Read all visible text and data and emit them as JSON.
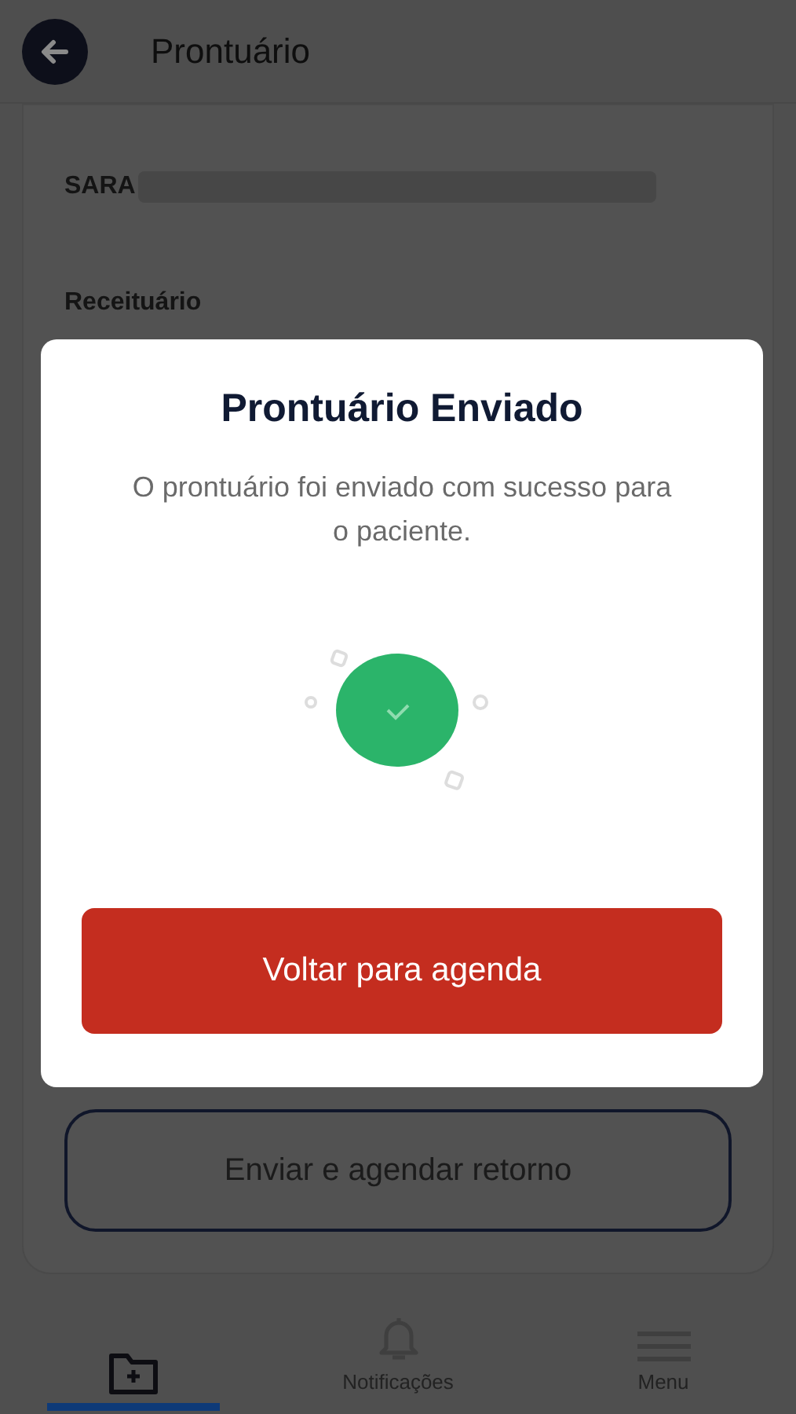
{
  "header": {
    "title": "Prontuário"
  },
  "record": {
    "patient_name": "SARA",
    "section_title": "Receituário"
  },
  "secondary_button": "Enviar e agendar retorno",
  "bottom_nav": [
    {
      "kind": "folder",
      "selected": true
    },
    {
      "kind": "bell",
      "label": "Notificações",
      "selected": false
    },
    {
      "kind": "menu",
      "label": "Menu",
      "selected": false
    }
  ],
  "dialog": {
    "title": "Prontuário Enviado",
    "message": "O prontuário foi enviado com sucesso para o paciente.",
    "button": "Voltar para agenda"
  }
}
